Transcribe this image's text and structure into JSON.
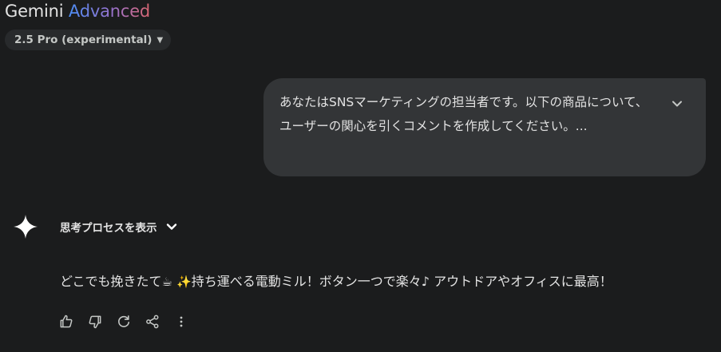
{
  "header": {
    "brand": "Gemini",
    "tier": "Advanced"
  },
  "model_selector": {
    "label": "2.5 Pro (experimental)"
  },
  "user_message": {
    "text": "あなたはSNSマーケティングの担当者です。以下の商品について、ユーザーの関心を引くコメントを作成してください。..."
  },
  "thinking": {
    "label": "思考プロセスを表示"
  },
  "response": {
    "before_emoji": "どこでも挽きたて",
    "emoji_1": "☕",
    "emoji_2": "✨",
    "after_emoji": "持ち運べる電動ミル！ボタン一つで楽々♪ アウトドアやオフィスに最高！"
  },
  "icons": {
    "expand": "chevron-down-icon",
    "gemini": "gemini-spark-icon",
    "like": "thumbs-up-icon",
    "dislike": "thumbs-down-icon",
    "regenerate": "refresh-icon",
    "share": "share-icon",
    "more": "more-vertical-icon"
  },
  "colors": {
    "background": "#1b1c1d",
    "bubble": "#333537",
    "chip": "#282a2c",
    "text": "#e3e3e3"
  }
}
